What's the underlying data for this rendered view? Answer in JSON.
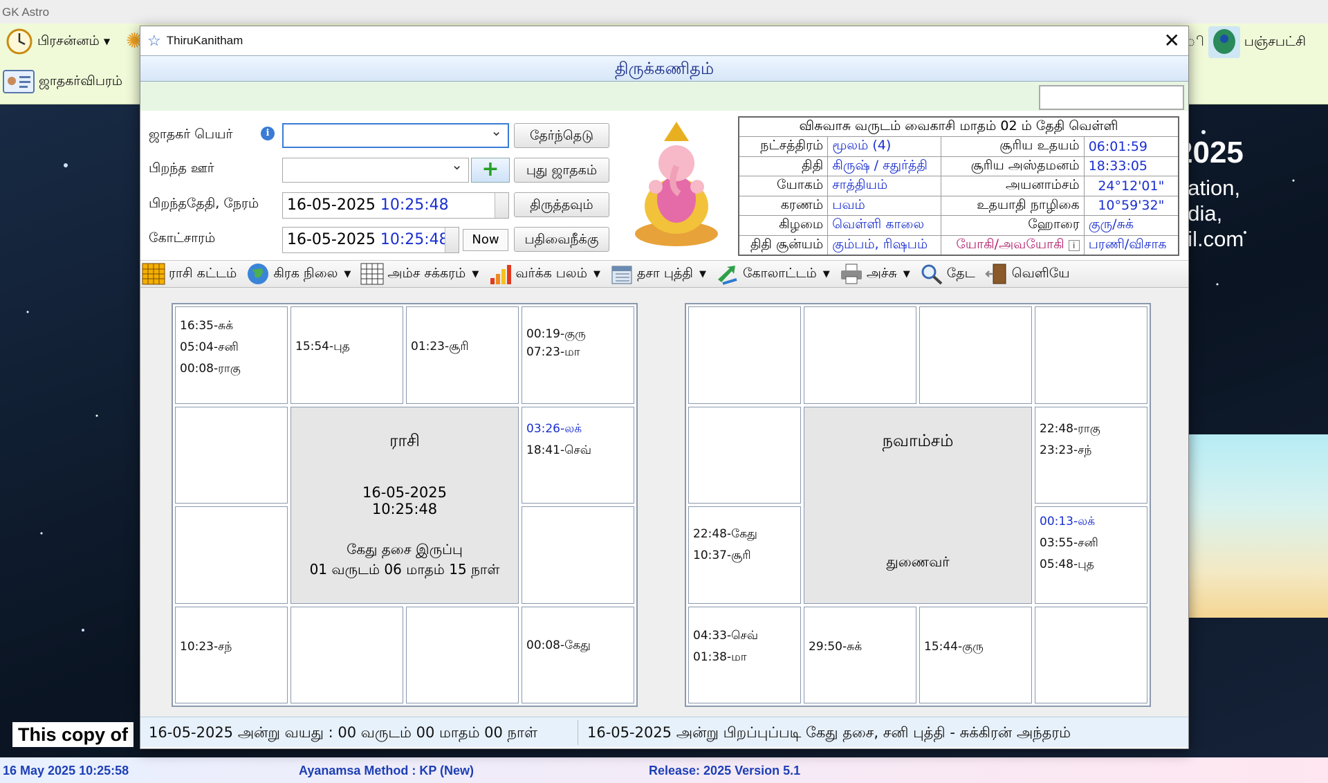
{
  "app": {
    "title": "GK  Astro"
  },
  "toolbar": {
    "prasannam": "பிரசன்னம்",
    "panchapakshi": "பஞ்சபட்சி",
    "jathakar_vibaram": "ஜாதகர்விபரம்",
    "partial": "ி"
  },
  "background": {
    "year": "2025",
    "line1": "dation,",
    "line2": "ndia,",
    "line3": "ail.com",
    "copy_notice": "This copy of"
  },
  "statusbar": {
    "datetime": "16 May 2025  10:25:58",
    "ayanamsa": "Ayanamsa Method : KP (New)",
    "release": "Release: 2025 Version 5.1"
  },
  "window": {
    "title": "ThiruKanitham",
    "header": "திருக்கணிதம்"
  },
  "form": {
    "name_label": "ஜாதகர் பெயர்",
    "place_label": "பிறந்த ஊர்",
    "dob_label": "பிறந்ததேதி, நேரம்",
    "transit_label": "கோட்சாரம்",
    "dob_date": "16-05-2025",
    "dob_time": "10:25:48",
    "transit_date": "16-05-2025",
    "transit_time": "10:25:48",
    "now_btn": "Now",
    "search_btn": "தேர்ந்தெடு",
    "new_btn": "புது ஜாதகம்",
    "edit_btn": "திருத்தவும்",
    "delete_btn": "பதிவைநீக்கு"
  },
  "panchang": {
    "header": "விசுவாசு வருடம் வைகாசி மாதம் 02 ம் தேதி வெள்ளி",
    "rows": [
      {
        "k1": "நட்சத்திரம்",
        "v1": "மூலம் (4)",
        "k2": "சூரிய உதயம்",
        "v2": "06:01:59"
      },
      {
        "k1": "திதி",
        "v1": "கிருஷ் / சதுர்த்தி",
        "k2": "சூரிய அஸ்தமனம்",
        "v2": "18:33:05"
      },
      {
        "k1": "யோகம்",
        "v1": "சாத்தியம்",
        "k2": "அயனாம்சம்",
        "v2": "24°12'01\""
      },
      {
        "k1": "கரணம்",
        "v1": "பவம்",
        "k2": "உதயாதி நாழிகை",
        "v2": "10°59'32\""
      },
      {
        "k1": "கிழமை",
        "v1": "வெள்ளி காலை",
        "k2": "ஹோரை",
        "v2": "குரு/சுக்"
      },
      {
        "k1": "திதி சூன்யம்",
        "v1": "கும்பம், ரிஷபம்",
        "k2": "யோகி/அவயோகி",
        "v2": "பரணி/விசாக"
      }
    ]
  },
  "menu": {
    "rasi": "ராசி கட்டம்",
    "graha": "கிரக நிலை",
    "amsa": "அம்ச சக்கரம்",
    "varga": "வர்க்க பலம்",
    "dasa": "தசா புத்தி",
    "transit": "கோலாட்டம்",
    "print": "அச்சு",
    "search": "தேட",
    "exit": "வெளியே"
  },
  "rasi": {
    "title": "ராசி",
    "date": "16-05-2025",
    "time": "10:25:48",
    "dasa1": "கேது தசை இருப்பு",
    "dasa2": "01 வருடம் 06 மாதம் 15 நாள்",
    "c0a": "16:35-சுக்",
    "c0b": "05:04-சனி",
    "c0c": "00:08-ராகு",
    "c1a": "15:54-புத",
    "c2a": "01:23-சூரி",
    "c3a": "00:19-குரு",
    "c3b": "07:23-மா",
    "c7a": "03:26-லக்",
    "c7b": "18:41-செவ்",
    "c12a": "10:23-சந்",
    "c15a": "00:08-கேது"
  },
  "navamsa": {
    "title": "நவாம்சம்",
    "sub": "துணைவர்",
    "c7a": "22:48-ராகு",
    "c7b": "23:23-சந்",
    "c8a": "22:48-கேது",
    "c8b": "10:37-சூரி",
    "c11a": "00:13-லக்",
    "c11b": "03:55-சனி",
    "c11c": "05:48-புத",
    "c12a": "04:33-செவ்",
    "c12b": "01:38-மா",
    "c13a": "29:50-சுக்",
    "c14a": "15:44-குரு"
  },
  "footer": {
    "age": "16-05-2025  அன்று  வயது  :  00  வருடம்  00  மாதம்  00  நாள்",
    "dasa": "16-05-2025  அன்று  பிறப்புப்படி  கேது  தசை,  சனி  புத்தி  -  சுக்கிரன்  அந்தரம்"
  }
}
